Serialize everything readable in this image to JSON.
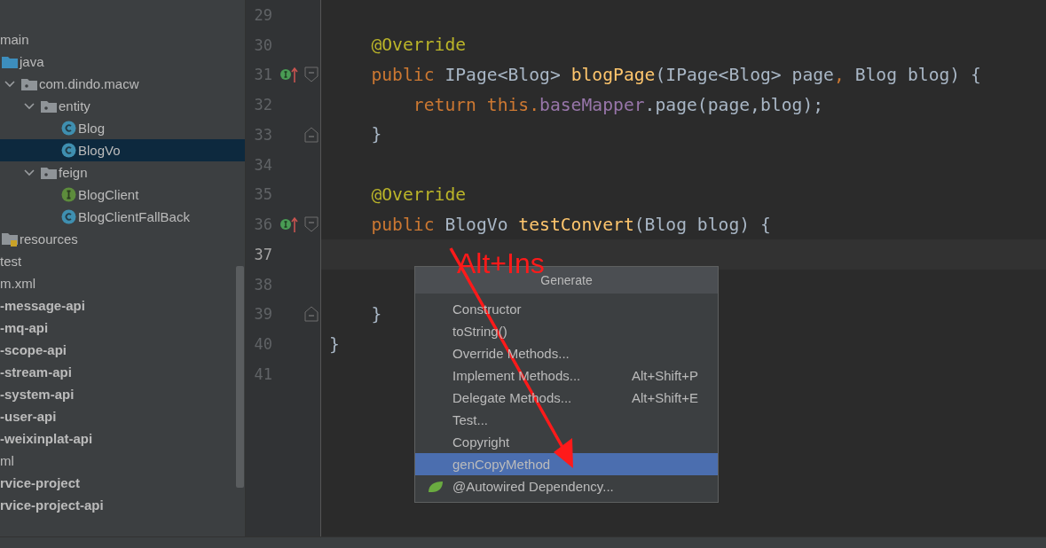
{
  "project_tree": [
    {
      "label": "main",
      "module": false,
      "selected": false,
      "children": [
        {
          "label": "java",
          "kind": "source-folder",
          "module": false,
          "selected": false,
          "children": [
            {
              "label": "com.dindo.macw",
              "kind": "package",
              "expanded": true,
              "module": false,
              "selected": false,
              "children": [
                {
                  "label": "entity",
                  "kind": "package",
                  "expanded": true,
                  "module": false,
                  "selected": false,
                  "children": [
                    {
                      "label": "Blog",
                      "kind": "class",
                      "module": false,
                      "selected": false
                    },
                    {
                      "label": "BlogVo",
                      "kind": "class",
                      "module": false,
                      "selected": true
                    }
                  ]
                },
                {
                  "label": "feign",
                  "kind": "package",
                  "expanded": true,
                  "module": false,
                  "selected": false,
                  "children": [
                    {
                      "label": "BlogClient",
                      "kind": "interface",
                      "module": false,
                      "selected": false
                    },
                    {
                      "label": "BlogClientFallBack",
                      "kind": "class",
                      "module": false,
                      "selected": false
                    }
                  ]
                }
              ]
            }
          ]
        },
        {
          "label": "resources",
          "kind": "resources-folder",
          "module": false,
          "selected": false
        }
      ]
    },
    {
      "label": "test",
      "module": false,
      "selected": false
    },
    {
      "label": "m.xml",
      "module": false,
      "selected": false
    },
    {
      "label": "-message-api",
      "module": true,
      "selected": false
    },
    {
      "label": "-mq-api",
      "module": true,
      "selected": false
    },
    {
      "label": "-scope-api",
      "module": true,
      "selected": false
    },
    {
      "label": "-stream-api",
      "module": true,
      "selected": false
    },
    {
      "label": "-system-api",
      "module": true,
      "selected": false
    },
    {
      "label": "-user-api",
      "module": true,
      "selected": false
    },
    {
      "label": "-weixinplat-api",
      "module": true,
      "selected": false
    },
    {
      "label": "ml",
      "module": false,
      "selected": false
    },
    {
      "label": "rvice-project",
      "module": true,
      "selected": false
    },
    {
      "label": "rvice-project-api",
      "module": true,
      "selected": false
    }
  ],
  "editor": {
    "lines": [
      {
        "number": "29",
        "current": false,
        "implemented": false,
        "fold_open": false,
        "fold_close": false
      },
      {
        "number": "30",
        "current": false,
        "implemented": false,
        "fold_open": false,
        "fold_close": false,
        "tokens": [
          {
            "kind": "annotation",
            "text": "    @Override"
          }
        ]
      },
      {
        "number": "31",
        "current": false,
        "implemented": true,
        "fold_open": true,
        "fold_close": false,
        "tokens": [
          {
            "kind": "keyword",
            "text": "    public"
          },
          {
            "kind": "plain",
            "text": " IPage<Blog> "
          },
          {
            "kind": "method",
            "text": "blogPage"
          },
          {
            "kind": "plain",
            "text": "(IPage<Blog> page"
          },
          {
            "kind": "keyword",
            "text": ","
          },
          {
            "kind": "plain",
            "text": " Blog blog) {"
          }
        ]
      },
      {
        "number": "32",
        "current": false,
        "implemented": false,
        "fold_open": false,
        "fold_close": false,
        "tokens": [
          {
            "kind": "keyword",
            "text": "        return this."
          },
          {
            "kind": "field",
            "text": "baseMapper"
          },
          {
            "kind": "plain",
            "text": ".page(page,blog);"
          }
        ]
      },
      {
        "number": "33",
        "current": false,
        "implemented": false,
        "fold_open": false,
        "fold_close": true,
        "tokens": [
          {
            "kind": "plain",
            "text": "    }"
          }
        ]
      },
      {
        "number": "34",
        "current": false,
        "implemented": false,
        "fold_open": false,
        "fold_close": false
      },
      {
        "number": "35",
        "current": false,
        "implemented": false,
        "fold_open": false,
        "fold_close": false,
        "tokens": [
          {
            "kind": "annotation",
            "text": "    @Override"
          }
        ]
      },
      {
        "number": "36",
        "current": false,
        "implemented": true,
        "fold_open": true,
        "fold_close": false,
        "tokens": [
          {
            "kind": "keyword",
            "text": "    public"
          },
          {
            "kind": "plain",
            "text": " BlogVo "
          },
          {
            "kind": "method",
            "text": "testConvert"
          },
          {
            "kind": "plain",
            "text": "(Blog blog) {"
          }
        ]
      },
      {
        "number": "37",
        "current": true,
        "implemented": false,
        "fold_open": false,
        "fold_close": false
      },
      {
        "number": "38",
        "current": false,
        "implemented": false,
        "fold_open": false,
        "fold_close": false
      },
      {
        "number": "39",
        "current": false,
        "implemented": false,
        "fold_open": false,
        "fold_close": true,
        "tokens": [
          {
            "kind": "plain",
            "text": "    }"
          }
        ]
      },
      {
        "number": "40",
        "current": false,
        "implemented": false,
        "fold_open": false,
        "fold_close": false,
        "tokens": [
          {
            "kind": "plain",
            "text": "}"
          }
        ]
      },
      {
        "number": "41",
        "current": false,
        "implemented": false,
        "fold_open": false,
        "fold_close": false
      }
    ]
  },
  "generate_popup": {
    "title": "Generate",
    "items": [
      {
        "label": "Constructor",
        "selected": false
      },
      {
        "label": "toString()",
        "selected": false
      },
      {
        "label": "Override Methods...",
        "selected": false
      },
      {
        "label": "Implement Methods...",
        "shortcut": "Alt+Shift+P",
        "selected": false
      },
      {
        "label": "Delegate Methods...",
        "shortcut": "Alt+Shift+E",
        "selected": false
      },
      {
        "label": "Test...",
        "selected": false
      },
      {
        "label": "Copyright",
        "selected": false
      },
      {
        "label": "genCopyMethod",
        "selected": true
      },
      {
        "label": "@Autowired Dependency...",
        "kind": "spring",
        "selected": false
      }
    ]
  },
  "annotation": {
    "text": "Alt+Ins"
  }
}
